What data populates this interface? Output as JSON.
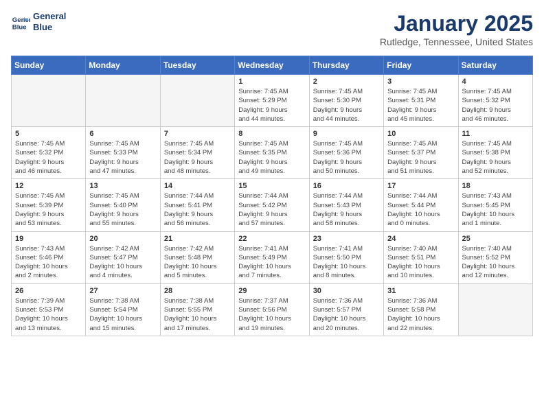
{
  "header": {
    "logo_line1": "General",
    "logo_line2": "Blue",
    "month": "January 2025",
    "location": "Rutledge, Tennessee, United States"
  },
  "weekdays": [
    "Sunday",
    "Monday",
    "Tuesday",
    "Wednesday",
    "Thursday",
    "Friday",
    "Saturday"
  ],
  "weeks": [
    [
      {
        "day": "",
        "info": ""
      },
      {
        "day": "",
        "info": ""
      },
      {
        "day": "",
        "info": ""
      },
      {
        "day": "1",
        "info": "Sunrise: 7:45 AM\nSunset: 5:29 PM\nDaylight: 9 hours\nand 44 minutes."
      },
      {
        "day": "2",
        "info": "Sunrise: 7:45 AM\nSunset: 5:30 PM\nDaylight: 9 hours\nand 44 minutes."
      },
      {
        "day": "3",
        "info": "Sunrise: 7:45 AM\nSunset: 5:31 PM\nDaylight: 9 hours\nand 45 minutes."
      },
      {
        "day": "4",
        "info": "Sunrise: 7:45 AM\nSunset: 5:32 PM\nDaylight: 9 hours\nand 46 minutes."
      }
    ],
    [
      {
        "day": "5",
        "info": "Sunrise: 7:45 AM\nSunset: 5:32 PM\nDaylight: 9 hours\nand 46 minutes."
      },
      {
        "day": "6",
        "info": "Sunrise: 7:45 AM\nSunset: 5:33 PM\nDaylight: 9 hours\nand 47 minutes."
      },
      {
        "day": "7",
        "info": "Sunrise: 7:45 AM\nSunset: 5:34 PM\nDaylight: 9 hours\nand 48 minutes."
      },
      {
        "day": "8",
        "info": "Sunrise: 7:45 AM\nSunset: 5:35 PM\nDaylight: 9 hours\nand 49 minutes."
      },
      {
        "day": "9",
        "info": "Sunrise: 7:45 AM\nSunset: 5:36 PM\nDaylight: 9 hours\nand 50 minutes."
      },
      {
        "day": "10",
        "info": "Sunrise: 7:45 AM\nSunset: 5:37 PM\nDaylight: 9 hours\nand 51 minutes."
      },
      {
        "day": "11",
        "info": "Sunrise: 7:45 AM\nSunset: 5:38 PM\nDaylight: 9 hours\nand 52 minutes."
      }
    ],
    [
      {
        "day": "12",
        "info": "Sunrise: 7:45 AM\nSunset: 5:39 PM\nDaylight: 9 hours\nand 53 minutes."
      },
      {
        "day": "13",
        "info": "Sunrise: 7:45 AM\nSunset: 5:40 PM\nDaylight: 9 hours\nand 55 minutes."
      },
      {
        "day": "14",
        "info": "Sunrise: 7:44 AM\nSunset: 5:41 PM\nDaylight: 9 hours\nand 56 minutes."
      },
      {
        "day": "15",
        "info": "Sunrise: 7:44 AM\nSunset: 5:42 PM\nDaylight: 9 hours\nand 57 minutes."
      },
      {
        "day": "16",
        "info": "Sunrise: 7:44 AM\nSunset: 5:43 PM\nDaylight: 9 hours\nand 58 minutes."
      },
      {
        "day": "17",
        "info": "Sunrise: 7:44 AM\nSunset: 5:44 PM\nDaylight: 10 hours\nand 0 minutes."
      },
      {
        "day": "18",
        "info": "Sunrise: 7:43 AM\nSunset: 5:45 PM\nDaylight: 10 hours\nand 1 minute."
      }
    ],
    [
      {
        "day": "19",
        "info": "Sunrise: 7:43 AM\nSunset: 5:46 PM\nDaylight: 10 hours\nand 2 minutes."
      },
      {
        "day": "20",
        "info": "Sunrise: 7:42 AM\nSunset: 5:47 PM\nDaylight: 10 hours\nand 4 minutes."
      },
      {
        "day": "21",
        "info": "Sunrise: 7:42 AM\nSunset: 5:48 PM\nDaylight: 10 hours\nand 5 minutes."
      },
      {
        "day": "22",
        "info": "Sunrise: 7:41 AM\nSunset: 5:49 PM\nDaylight: 10 hours\nand 7 minutes."
      },
      {
        "day": "23",
        "info": "Sunrise: 7:41 AM\nSunset: 5:50 PM\nDaylight: 10 hours\nand 8 minutes."
      },
      {
        "day": "24",
        "info": "Sunrise: 7:40 AM\nSunset: 5:51 PM\nDaylight: 10 hours\nand 10 minutes."
      },
      {
        "day": "25",
        "info": "Sunrise: 7:40 AM\nSunset: 5:52 PM\nDaylight: 10 hours\nand 12 minutes."
      }
    ],
    [
      {
        "day": "26",
        "info": "Sunrise: 7:39 AM\nSunset: 5:53 PM\nDaylight: 10 hours\nand 13 minutes."
      },
      {
        "day": "27",
        "info": "Sunrise: 7:38 AM\nSunset: 5:54 PM\nDaylight: 10 hours\nand 15 minutes."
      },
      {
        "day": "28",
        "info": "Sunrise: 7:38 AM\nSunset: 5:55 PM\nDaylight: 10 hours\nand 17 minutes."
      },
      {
        "day": "29",
        "info": "Sunrise: 7:37 AM\nSunset: 5:56 PM\nDaylight: 10 hours\nand 19 minutes."
      },
      {
        "day": "30",
        "info": "Sunrise: 7:36 AM\nSunset: 5:57 PM\nDaylight: 10 hours\nand 20 minutes."
      },
      {
        "day": "31",
        "info": "Sunrise: 7:36 AM\nSunset: 5:58 PM\nDaylight: 10 hours\nand 22 minutes."
      },
      {
        "day": "",
        "info": ""
      }
    ]
  ]
}
